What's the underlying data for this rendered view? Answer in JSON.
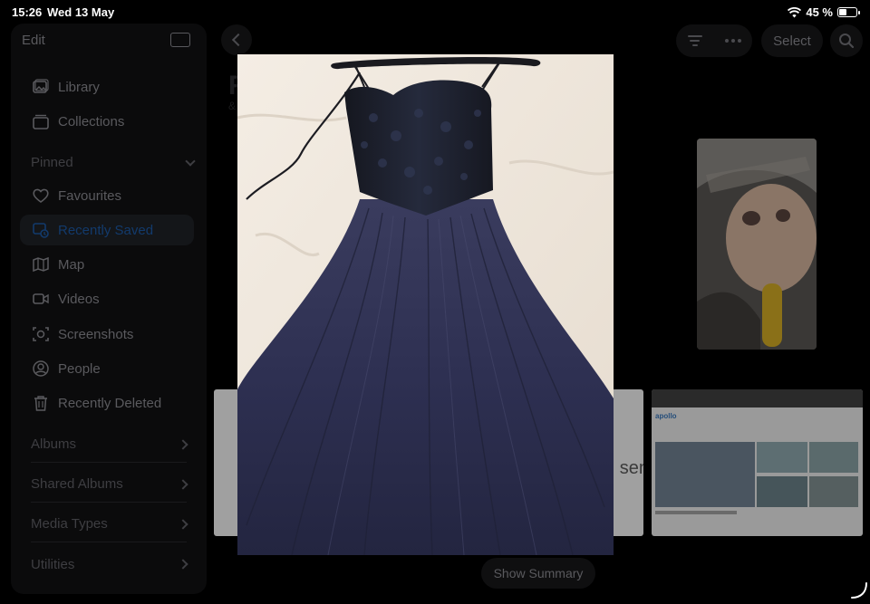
{
  "status_bar": {
    "time": "15:26",
    "date": "Wed 13 May",
    "battery_text": "45 %",
    "battery_level": 0.45
  },
  "sidebar": {
    "edit_label": "Edit",
    "toggle_icon": "sidebar-toggle-icon",
    "items": [
      {
        "label": "Library",
        "icon": "photo-library-icon"
      },
      {
        "label": "Collections",
        "icon": "collections-icon"
      }
    ],
    "pinned": {
      "header": "Pinned",
      "items": [
        {
          "label": "Favourites",
          "icon": "heart-icon"
        },
        {
          "label": "Recently Saved",
          "icon": "recently-saved-icon",
          "active": true
        },
        {
          "label": "Map",
          "icon": "map-icon"
        },
        {
          "label": "Videos",
          "icon": "video-icon"
        },
        {
          "label": "Screenshots",
          "icon": "screenshot-icon"
        },
        {
          "label": "People",
          "icon": "person-icon"
        },
        {
          "label": "Recently Deleted",
          "icon": "trash-icon"
        }
      ]
    },
    "groups": [
      "Albums",
      "Shared Albums",
      "Media Types",
      "Utilities"
    ]
  },
  "toolbar": {
    "back_icon": "chevron-left-icon",
    "filter_icon": "filter-icon",
    "more_icon": "ellipsis-icon",
    "select_label": "Select",
    "search_icon": "search-icon"
  },
  "library": {
    "partial_title": "R",
    "partial_subtitle": "&",
    "doc_thumb_text": "sen",
    "web_thumb_logo": "apollo"
  },
  "footer": {
    "show_summary_label": "Show Summary"
  },
  "colors": {
    "background": "#000000",
    "sidebar": "#0b0b0c",
    "dim_text": "#5a5a5e",
    "active_item_text": "#123a6c",
    "dress": "#2b2d4c"
  }
}
